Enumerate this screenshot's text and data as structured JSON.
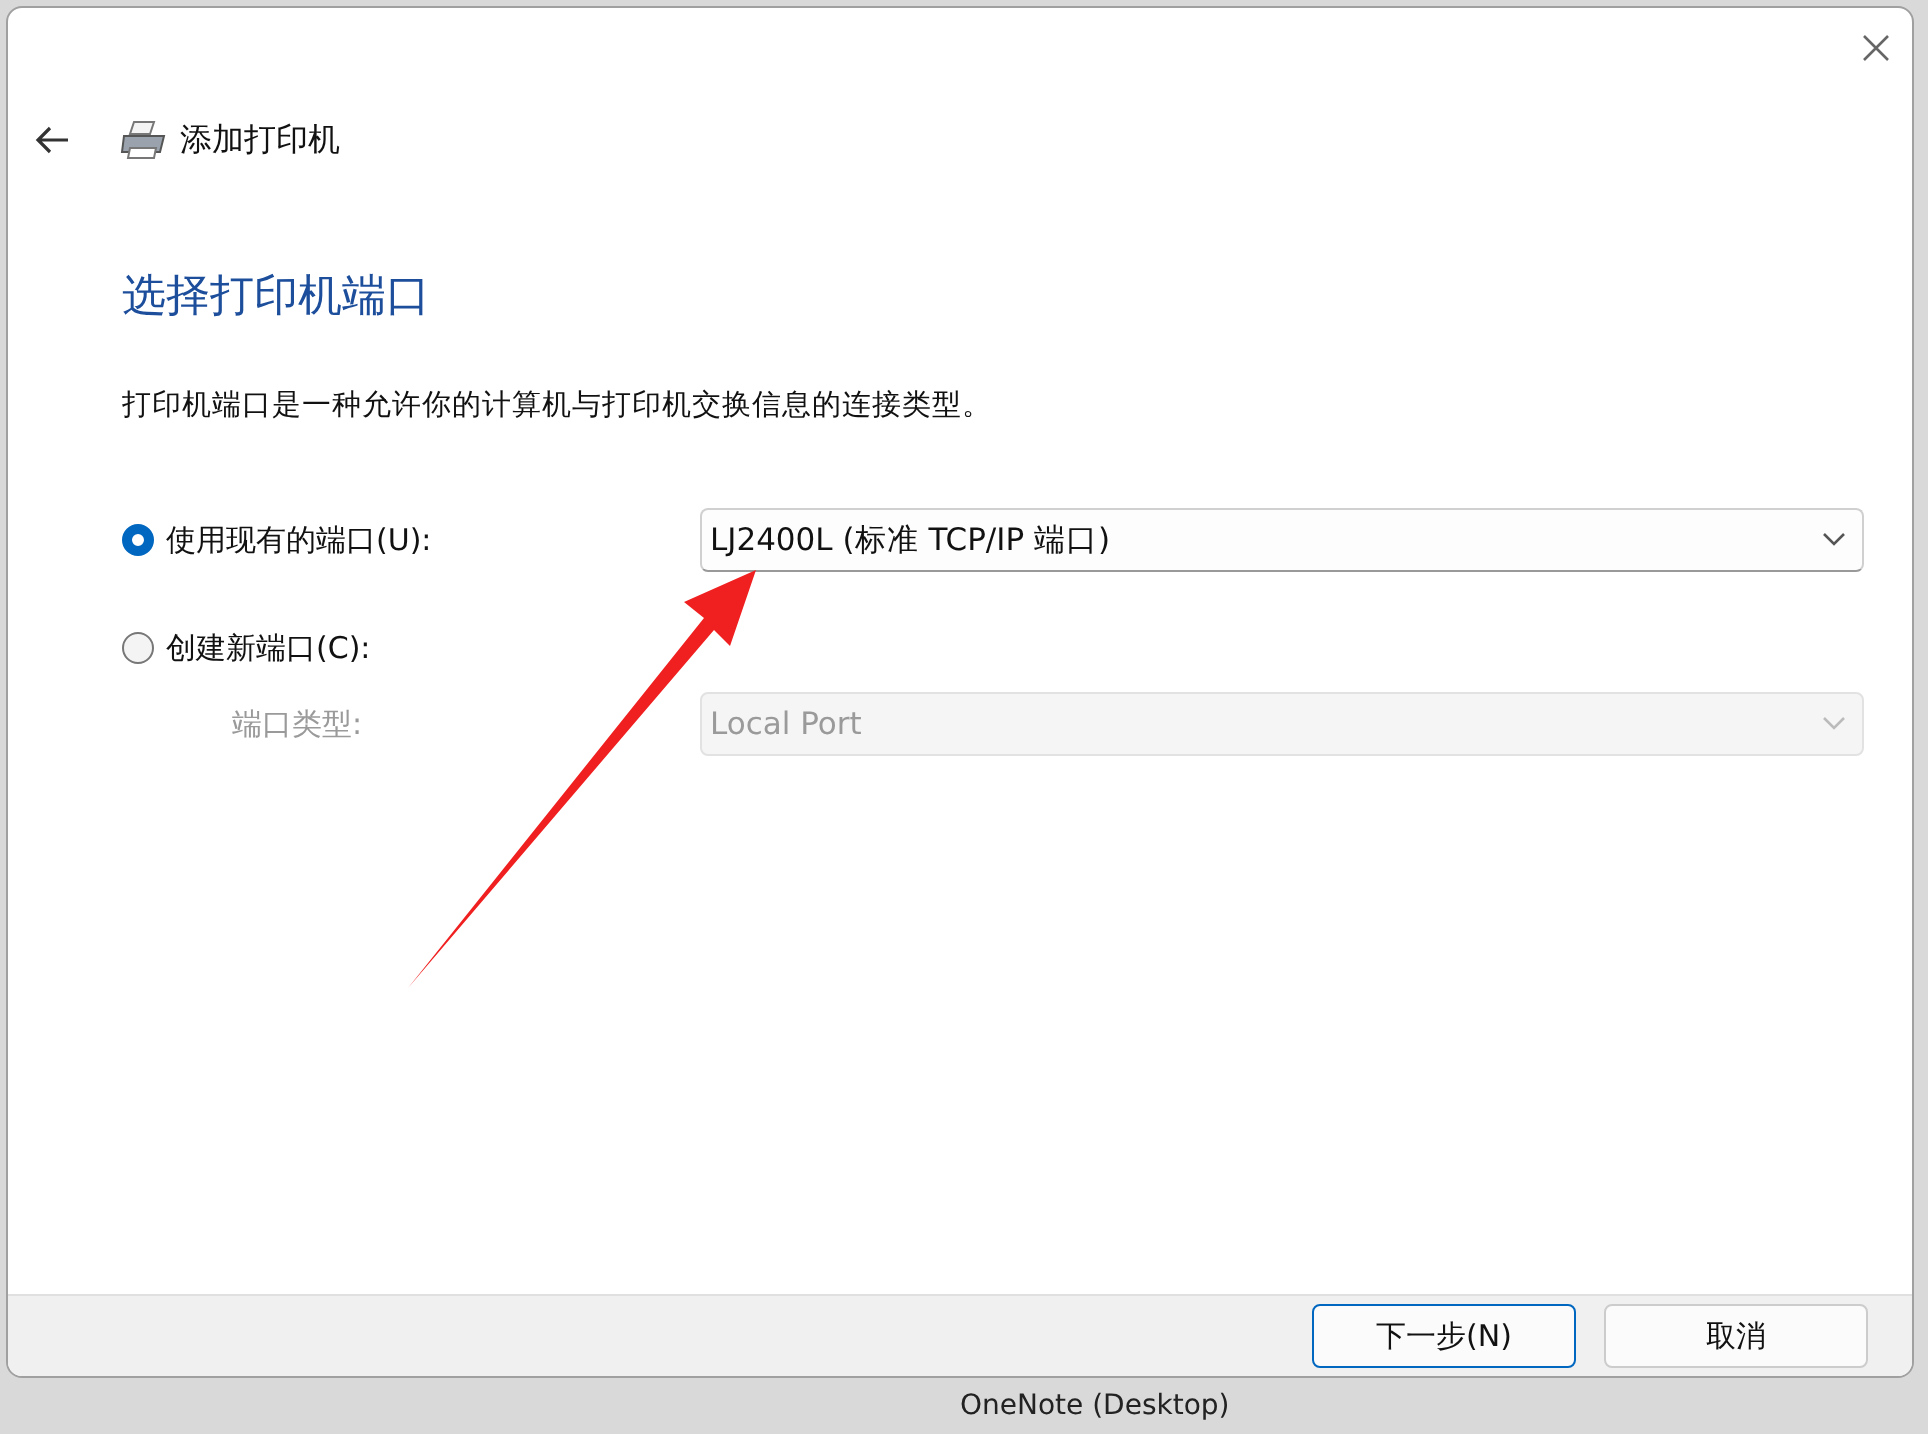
{
  "window": {
    "title": "添加打印机"
  },
  "heading": "选择打印机端口",
  "description": "打印机端口是一种允许你的计算机与打印机交换信息的连接类型。",
  "options": [
    {
      "label": "使用现有的端口(U):",
      "selected": true,
      "dropdown": {
        "value": "LJ2400L (标准 TCP/IP 端口)",
        "disabled": false
      }
    },
    {
      "label": "创建新端口(C):",
      "selected": false,
      "sub_label": "端口类型:",
      "dropdown": {
        "value": "Local Port",
        "disabled": true
      }
    }
  ],
  "buttons": [
    {
      "label": "下一步(N)",
      "default": true
    },
    {
      "label": "取消",
      "default": false
    }
  ],
  "background_window": {
    "item": "OneNote (Desktop)"
  }
}
